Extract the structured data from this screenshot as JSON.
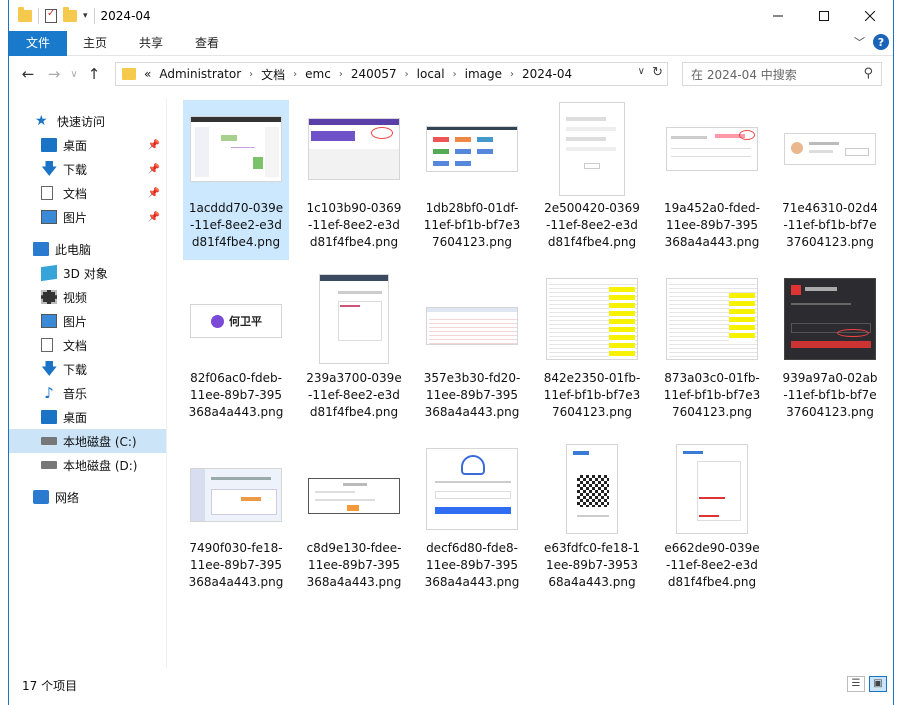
{
  "window": {
    "title": "2024-04",
    "controls": [
      "minimize",
      "maximize",
      "close"
    ]
  },
  "ribbon": {
    "tabs": [
      "文件",
      "主页",
      "共享",
      "查看"
    ]
  },
  "address": {
    "overflow": "«",
    "crumbs": [
      "Administrator",
      "文档",
      "emc",
      "240057",
      "local",
      "image",
      "2024-04"
    ]
  },
  "search": {
    "placeholder": "在 2024-04 中搜索"
  },
  "nav": {
    "items": [
      {
        "label": "快速访问",
        "icon": "star-icon",
        "indent": 0,
        "pinned": false
      },
      {
        "label": "桌面",
        "icon": "desktop-icon",
        "indent": 1,
        "pinned": true
      },
      {
        "label": "下载",
        "icon": "download-icon",
        "indent": 1,
        "pinned": true
      },
      {
        "label": "文档",
        "icon": "document-icon",
        "indent": 1,
        "pinned": true
      },
      {
        "label": "图片",
        "icon": "picture-icon",
        "indent": 1,
        "pinned": true
      },
      {
        "label": "此电脑",
        "icon": "computer-icon",
        "indent": 0,
        "pinned": false
      },
      {
        "label": "3D 对象",
        "icon": "3d-objects-icon",
        "indent": 1,
        "pinned": false
      },
      {
        "label": "视频",
        "icon": "video-icon",
        "indent": 1,
        "pinned": false
      },
      {
        "label": "图片",
        "icon": "picture-icon",
        "indent": 1,
        "pinned": false
      },
      {
        "label": "文档",
        "icon": "document-icon",
        "indent": 1,
        "pinned": false
      },
      {
        "label": "下载",
        "icon": "download-icon",
        "indent": 1,
        "pinned": false
      },
      {
        "label": "音乐",
        "icon": "music-icon",
        "indent": 1,
        "pinned": false
      },
      {
        "label": "桌面",
        "icon": "desktop-icon",
        "indent": 1,
        "pinned": false
      },
      {
        "label": "本地磁盘 (C:)",
        "icon": "drive-c-icon",
        "indent": 1,
        "pinned": false,
        "selected": true
      },
      {
        "label": "本地磁盘 (D:)",
        "icon": "drive-d-icon",
        "indent": 1,
        "pinned": false
      },
      {
        "label": "网络",
        "icon": "network-icon",
        "indent": 0,
        "pinned": false
      }
    ]
  },
  "files": [
    {
      "name": "1acddd70-039e-11ef-8ee2-e3dd81f4fbe4.png",
      "selected": true
    },
    {
      "name": "1c103b90-0369-11ef-8ee2-e3dd81f4fbe4.png"
    },
    {
      "name": "1db28bf0-01df-11ef-bf1b-bf7e37604123.png"
    },
    {
      "name": "2e500420-0369-11ef-8ee2-e3dd81f4fbe4.png"
    },
    {
      "name": "19a452a0-fded-11ee-89b7-395368a4a443.png"
    },
    {
      "name": "71e46310-02d4-11ef-bf1b-bf7e37604123.png"
    },
    {
      "name": "82f06ac0-fdeb-11ee-89b7-395368a4a443.png"
    },
    {
      "name": "239a3700-039e-11ef-8ee2-e3dd81f4fbe4.png"
    },
    {
      "name": "357e3b30-fd20-11ee-89b7-395368a4a443.png"
    },
    {
      "name": "842e2350-01fb-11ef-bf1b-bf7e37604123.png"
    },
    {
      "name": "873a03c0-01fb-11ef-bf1b-bf7e37604123.png"
    },
    {
      "name": "939a97a0-02ab-11ef-bf1b-bf7e37604123.png"
    },
    {
      "name": "7490f030-fe18-11ee-89b7-395368a4a443.png"
    },
    {
      "name": "c8d9e130-fdee-11ee-89b7-395368a4a443.png"
    },
    {
      "name": "decf6d80-fde8-11ee-89b7-395368a4a443.png"
    },
    {
      "name": "e63fdfc0-fe18-11ee-89b7-395368a4a443.png"
    },
    {
      "name": "e662de90-039e-11ef-8ee2-e3dd81f4fbe4.png"
    }
  ],
  "thumb_text": {
    "name_badge": "何卫平"
  },
  "status": {
    "count": "17 个项目"
  }
}
